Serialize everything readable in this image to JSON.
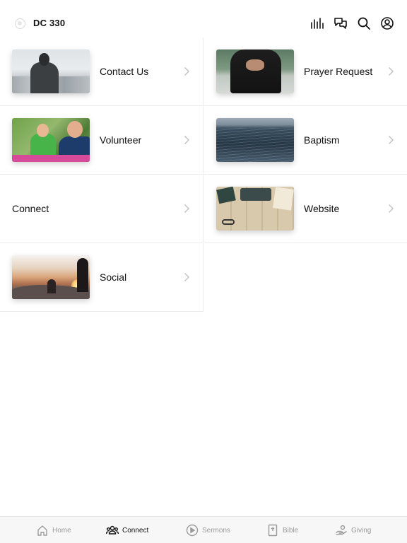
{
  "header": {
    "title": "DC 330",
    "icons": [
      "logo-icon",
      "audio-bars-icon",
      "chat-icon",
      "search-icon",
      "account-icon"
    ]
  },
  "grid": {
    "items": [
      {
        "label": "Contact Us",
        "image": "person-overlooking-city"
      },
      {
        "label": "Prayer Request",
        "image": "praying-hands"
      },
      {
        "label": "Volunteer",
        "image": "kids-painting-outdoors"
      },
      {
        "label": "Baptism",
        "image": "lake-water"
      },
      {
        "label": "Connect",
        "image": ""
      },
      {
        "label": "Website",
        "image": "desk-with-typewriter"
      },
      {
        "label": "Social",
        "image": "people-at-sunset"
      }
    ]
  },
  "nav": {
    "items": [
      {
        "label": "Home",
        "icon": "home-icon",
        "active": false
      },
      {
        "label": "Connect",
        "icon": "people-icon",
        "active": true
      },
      {
        "label": "Sermons",
        "icon": "play-circle-icon",
        "active": false
      },
      {
        "label": "Bible",
        "icon": "bible-icon",
        "active": false
      },
      {
        "label": "Giving",
        "icon": "giving-hand-icon",
        "active": false
      }
    ]
  },
  "colors": {
    "text": "#111111",
    "inactive": "#9a9a9a",
    "divider": "#ececec",
    "nav_bg": "#f7f7f7"
  }
}
